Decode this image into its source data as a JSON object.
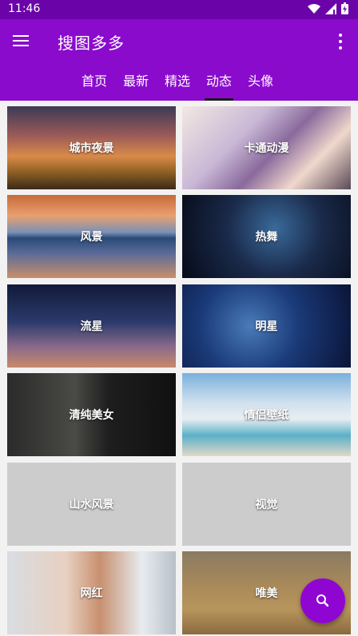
{
  "status_bar": {
    "time": "11:46",
    "icons": [
      "wifi-icon",
      "signal-icon",
      "battery-icon"
    ]
  },
  "app_bar": {
    "title": "搜图多多",
    "menu_icon": "menu-icon",
    "more_icon": "more-vert-icon"
  },
  "tabs": [
    {
      "label": "首页",
      "active": false
    },
    {
      "label": "最新",
      "active": false
    },
    {
      "label": "精选",
      "active": false
    },
    {
      "label": "动态",
      "active": true
    },
    {
      "label": "头像",
      "active": false
    }
  ],
  "categories": [
    {
      "label": "城市夜景"
    },
    {
      "label": "卡通动漫"
    },
    {
      "label": "风景"
    },
    {
      "label": "热舞"
    },
    {
      "label": "流星"
    },
    {
      "label": "明星"
    },
    {
      "label": "清纯美女"
    },
    {
      "label": "情侣壁纸"
    },
    {
      "label": "山水风景"
    },
    {
      "label": "视觉"
    },
    {
      "label": "网红"
    },
    {
      "label": "唯美"
    }
  ],
  "fab": {
    "icon": "search-icon"
  },
  "colors": {
    "primary": "#8a0bcc",
    "status_bar": "#6a04a8",
    "fab": "#8f06d2",
    "placeholder": "#cccccc"
  }
}
